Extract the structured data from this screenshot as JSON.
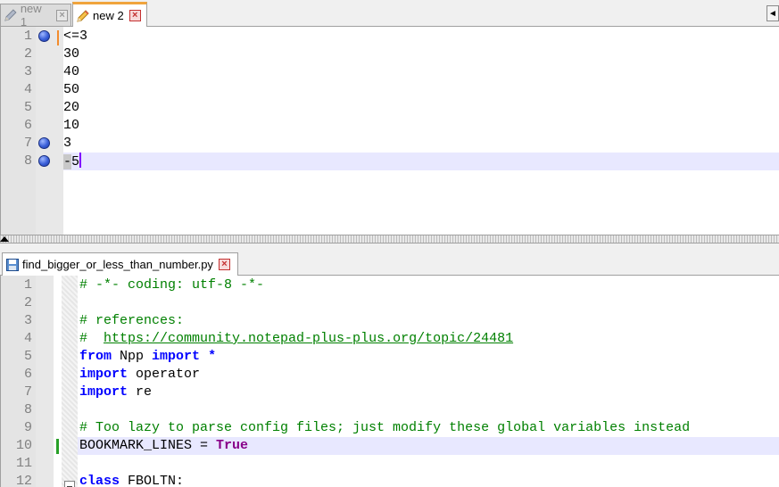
{
  "top_tabs": [
    {
      "label": "new 1",
      "state": "inactive"
    },
    {
      "label": "new 2",
      "state": "active"
    }
  ],
  "top_tab_scroll": "◄",
  "top_editor": {
    "lines": [
      {
        "num": "1",
        "text": "<=3",
        "bookmark": true
      },
      {
        "num": "2",
        "text": "30",
        "bookmark": false
      },
      {
        "num": "3",
        "text": "40",
        "bookmark": false
      },
      {
        "num": "4",
        "text": "50",
        "bookmark": false
      },
      {
        "num": "5",
        "text": "20",
        "bookmark": false
      },
      {
        "num": "6",
        "text": "10",
        "bookmark": false
      },
      {
        "num": "7",
        "text": "3",
        "bookmark": true
      },
      {
        "num": "8",
        "text": "-5",
        "bookmark": true
      }
    ]
  },
  "bottom_tab": {
    "label": "find_bigger_or_less_than_number.py"
  },
  "bottom_editor": {
    "lines": [
      {
        "num": "1",
        "segments": [
          {
            "t": "# -*- coding: utf-8 -*-",
            "c": "cmt"
          }
        ]
      },
      {
        "num": "2",
        "segments": []
      },
      {
        "num": "3",
        "segments": [
          {
            "t": "# references:",
            "c": "cmt"
          }
        ]
      },
      {
        "num": "4",
        "segments": [
          {
            "t": "#  ",
            "c": "cmt"
          },
          {
            "t": "https://community.notepad-plus-plus.org/topic/24481",
            "c": "url"
          }
        ]
      },
      {
        "num": "5",
        "segments": [
          {
            "t": "from",
            "c": "kw"
          },
          {
            "t": " Npp ",
            "c": ""
          },
          {
            "t": "import",
            "c": "kw"
          },
          {
            "t": " ",
            "c": ""
          },
          {
            "t": "*",
            "c": "kw"
          }
        ]
      },
      {
        "num": "6",
        "segments": [
          {
            "t": "import",
            "c": "kw"
          },
          {
            "t": " operator",
            "c": ""
          }
        ]
      },
      {
        "num": "7",
        "segments": [
          {
            "t": "import",
            "c": "kw"
          },
          {
            "t": " re",
            "c": ""
          }
        ]
      },
      {
        "num": "8",
        "segments": []
      },
      {
        "num": "9",
        "segments": [
          {
            "t": "# Too lazy to parse config files; just modify these global variables instead",
            "c": "cmt"
          }
        ]
      },
      {
        "num": "10",
        "segments": [
          {
            "t": "BOOKMARK_LINES = ",
            "c": ""
          },
          {
            "t": "True",
            "c": "kw2"
          }
        ]
      },
      {
        "num": "11",
        "segments": []
      },
      {
        "num": "12",
        "segments": [
          {
            "t": "class",
            "c": "kw"
          },
          {
            "t": " FBOLTN:",
            "c": ""
          }
        ]
      }
    ]
  }
}
